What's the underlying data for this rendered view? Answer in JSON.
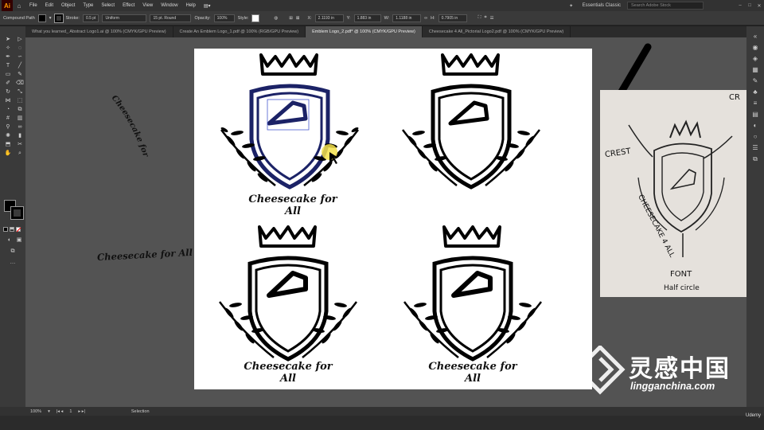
{
  "menubar": {
    "logo": "Ai",
    "items": [
      "File",
      "Edit",
      "Object",
      "Type",
      "Select",
      "Effect",
      "View",
      "Window",
      "Help"
    ],
    "workspace": "Essentials Classic",
    "search_placeholder": "Search Adobe Stock"
  },
  "control": {
    "selection_type": "Compound Path",
    "stroke_label": "Stroke:",
    "stroke_weight": "0.5 pt",
    "profile": "Uniform",
    "brush": "15 pt. Round",
    "opacity_label": "Opacity:",
    "opacity": "100%",
    "style_label": "Style:",
    "x_value": "2.1193 in",
    "y_value": "1.883 in",
    "w_value": "1.1188 in",
    "h_value": "0.7905 in"
  },
  "tabs": [
    "What you learned_ Abstract Logo1.ai @ 100% (CMYK/GPU Preview)",
    "Create An Emblem Logo_1.pdf @ 100% (RGB/GPU Preview)",
    "Emblem Logo_2.pdf* @ 100% (CMYK/GPU Preview)",
    "Cheesecake 4 All_Pictorial Logo2.pdf @ 100% (CMYK/GPU Preview)"
  ],
  "active_tab_index": 2,
  "artwork": {
    "emblem_text": "Cheesecake for All",
    "loose_text_arc": "Cheesecake for All",
    "loose_text_straight": "Cheesecake for All"
  },
  "sketch": {
    "labels": [
      "CREST",
      "CHEESECAKE 4 ALL",
      "FONT",
      "Half circle",
      "CR"
    ]
  },
  "status": {
    "zoom": "100%",
    "artboard": "1",
    "tool": "Selection"
  },
  "watermark": {
    "cn": "灵感中国",
    "en": "lingganchina.com"
  },
  "udemy": "Udemy",
  "colors": {
    "app_bg": "#535353",
    "ai_orange": "#ff9a00",
    "selection_blue": "#4a5bd0",
    "cursor_yellow": "#f4e24a"
  }
}
